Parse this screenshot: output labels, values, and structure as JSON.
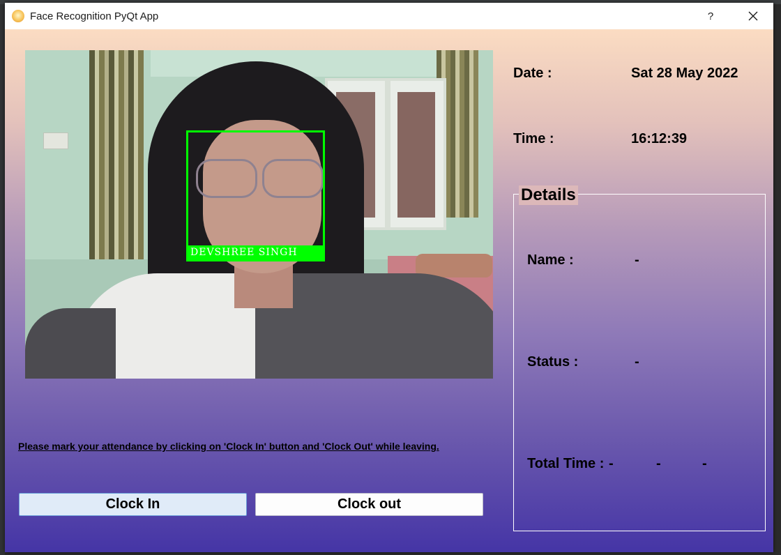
{
  "window": {
    "title": "Face Recognition PyQt App",
    "help_label": "?",
    "icon": "lightbulb-icon",
    "close_icon": "close-icon"
  },
  "camera": {
    "detected_name": "DEVSHREE  SINGH",
    "box_color": "#00ff00"
  },
  "info": {
    "date_label": "Date :",
    "date_value": "Sat 28 May 2022",
    "time_label": "Time :",
    "time_value": "16:12:39"
  },
  "details": {
    "title": "Details",
    "name_label": "Name :",
    "name_value": "-",
    "status_label": "Status :",
    "status_value": "-",
    "total_time_label": "Total Time :",
    "total_time_hours": "-",
    "total_time_minutes": "-",
    "total_time_seconds": "-"
  },
  "instruction": "Please mark your attendance by clicking on 'Clock In' button and 'Clock Out' while leaving.",
  "buttons": {
    "clock_in": "Clock In",
    "clock_out": "Clock out"
  },
  "colors": {
    "gradient_top": "#fbdcc2",
    "gradient_bottom": "#4535a6",
    "clock_in_bg": "#e0ebf8"
  }
}
